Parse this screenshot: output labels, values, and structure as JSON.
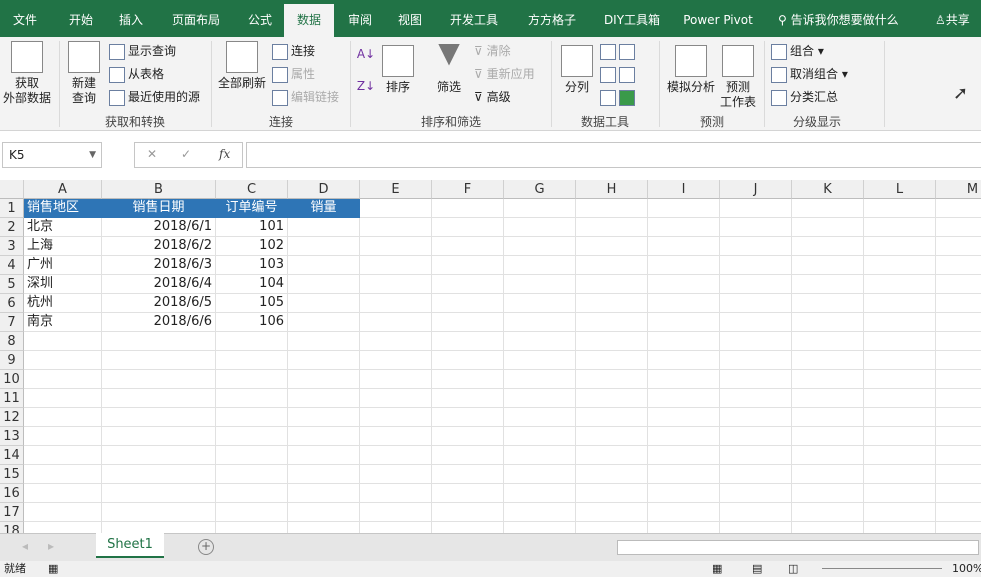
{
  "tabs": [
    "文件",
    "开始",
    "插入",
    "页面布局",
    "公式",
    "数据",
    "审阅",
    "视图",
    "开发工具",
    "方方格子",
    "DIY工具箱",
    "Power Pivot"
  ],
  "active_tab": "数据",
  "tell_me": "告诉我你想要做什么",
  "share": "共享",
  "ribbon": {
    "get_external": [
      "获取",
      "外部数据"
    ],
    "new_query": [
      "新建",
      "查询"
    ],
    "show_query": "显示查询",
    "from_table": "从表格",
    "recent_sources": "最近使用的源",
    "group1": "获取和转换",
    "refresh_all": "全部刷新",
    "connections": "连接",
    "properties": "属性",
    "edit_links": "编辑链接",
    "group2": "连接",
    "sort": "排序",
    "filter": "筛选",
    "clear": "清除",
    "reapply": "重新应用",
    "advanced": "高级",
    "group3": "排序和筛选",
    "text_to_columns": "分列",
    "group4": "数据工具",
    "what_if": "模拟分析",
    "forecast_sheet": [
      "预测",
      "工作表"
    ],
    "group5": "预测",
    "group_btn": "组合",
    "ungroup": "取消组合",
    "subtotal": "分类汇总",
    "group6": "分级显示"
  },
  "name_box": "K5",
  "fx": "fx",
  "columns": [
    "A",
    "B",
    "C",
    "D",
    "E",
    "F",
    "G",
    "H",
    "I",
    "J",
    "K",
    "L",
    "M"
  ],
  "rows": [
    [
      "销售地区",
      "销售日期",
      "订单编号",
      "销量"
    ],
    [
      "北京",
      "2018/6/1",
      "101",
      ""
    ],
    [
      "上海",
      "2018/6/2",
      "102",
      ""
    ],
    [
      "广州",
      "2018/6/3",
      "103",
      ""
    ],
    [
      "深圳",
      "2018/6/4",
      "104",
      ""
    ],
    [
      "杭州",
      "2018/6/5",
      "105",
      ""
    ],
    [
      "南京",
      "2018/6/6",
      "106",
      ""
    ]
  ],
  "row_count": 18,
  "sheet_tab": "Sheet1",
  "status": "就绪",
  "zoom": "100%",
  "colors": {
    "brand": "#217346",
    "header_fill": "#2e75b6"
  }
}
